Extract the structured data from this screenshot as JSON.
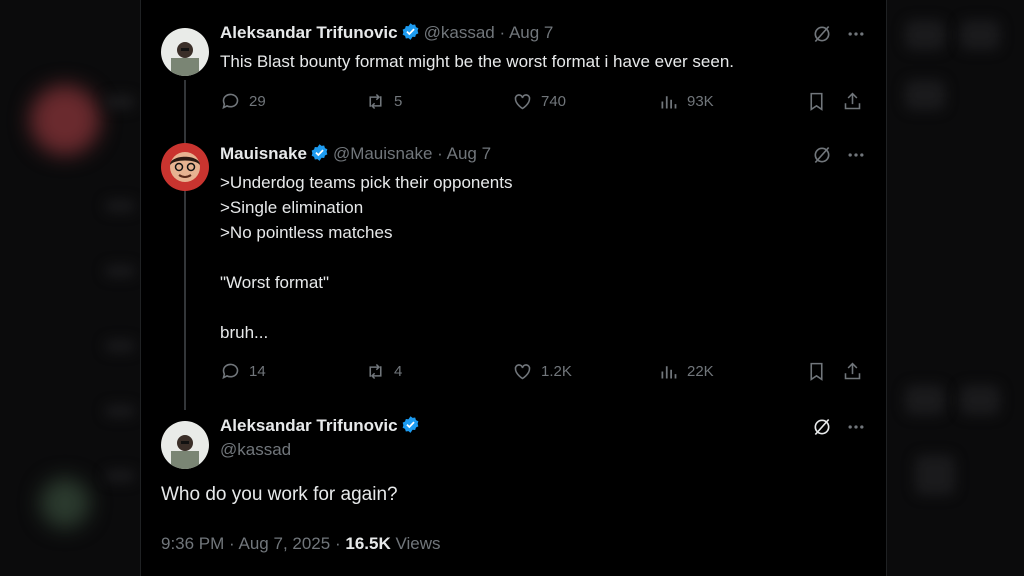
{
  "tweets": [
    {
      "author": "Aleksandar Trifunovic",
      "handle": "@kassad",
      "sep": "·",
      "date": "Aug 7",
      "text": "This Blast bounty format might be the worst format i have ever seen.",
      "replies": "29",
      "retweets": "5",
      "likes": "740",
      "views": "93K"
    },
    {
      "author": "Mauisnake",
      "handle": "@Mauisnake",
      "sep": "·",
      "date": "Aug 7",
      "text": ">Underdog teams pick their opponents\n>Single elimination\n>No pointless matches\n\n\"Worst format\"\n\nbruh...",
      "replies": "14",
      "retweets": "4",
      "likes": "1.2K",
      "views": "22K"
    }
  ],
  "main_tweet": {
    "author": "Aleksandar Trifunovic",
    "handle": "@kassad",
    "text": "Who do you work for again?",
    "time": "9:36 PM",
    "date": "Aug 7, 2025",
    "views_count": "16.5K",
    "views_label": "Views",
    "sep": "·"
  },
  "colors": {
    "verified": "#1d9bf0",
    "muted": "#71767b",
    "text": "#e7e9ea",
    "background": "#000000"
  },
  "icons": [
    "verified-badge-icon",
    "grok-icon",
    "more-icon",
    "reply-icon",
    "retweet-icon",
    "like-icon",
    "views-icon",
    "bookmark-icon",
    "share-icon"
  ]
}
